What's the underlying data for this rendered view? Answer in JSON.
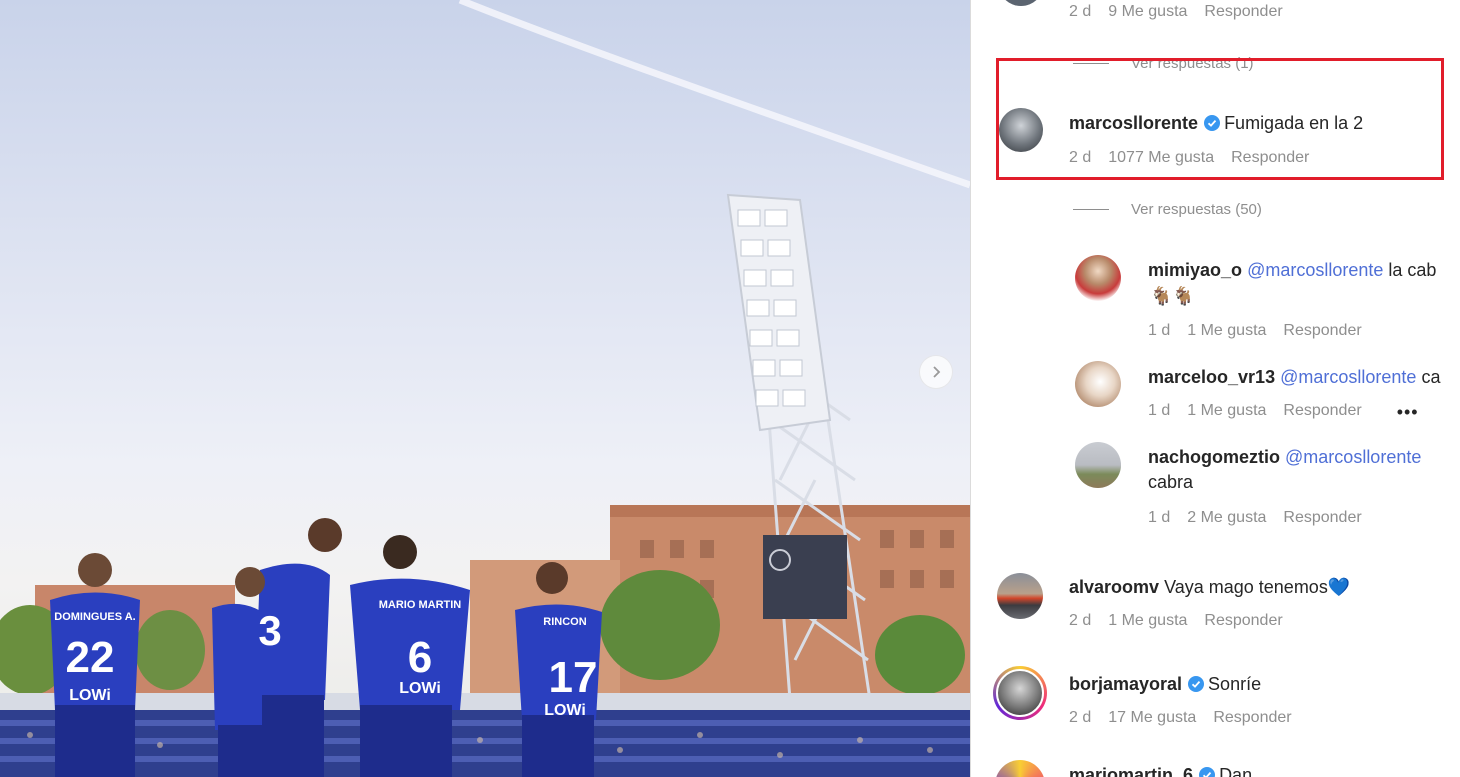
{
  "post": {
    "carousel_next_icon": "chevron-right-icon",
    "jerseys": [
      {
        "name": "DOMINGUES A.",
        "number": "22"
      },
      {
        "name": "",
        "number": "3"
      },
      {
        "name": "MARIO MARTIN",
        "number": "6"
      },
      {
        "name": "RINCON",
        "number": "17"
      }
    ],
    "sponsor": "LOWi"
  },
  "comments": [
    {
      "user": "",
      "text": "",
      "age": "2 d",
      "likes": "9 Me gusta",
      "reply": "Responder"
    },
    {
      "view_replies": "Ver respuestas (1)"
    },
    {
      "user": "marcosllorente",
      "verified": true,
      "text": "Fumigada en la 2",
      "age": "2 d",
      "likes": "1077 Me gusta",
      "reply": "Responder",
      "highlighted": true
    },
    {
      "view_replies": "Ver respuestas (50)"
    }
  ],
  "replies": [
    {
      "user": "mimiyao_o",
      "mention": "@marcosllorente",
      "text": "la cab",
      "line2": "🐐🐐",
      "age": "1 d",
      "likes": "1 Me gusta",
      "reply": "Responder"
    },
    {
      "user": "marceloo_vr13",
      "mention": "@marcosllorente",
      "text": "ca",
      "age": "1 d",
      "likes": "1 Me gusta",
      "reply": "Responder",
      "more": "•••"
    },
    {
      "user": "nachogomeztio",
      "mention": "@marcosllorente",
      "text": "",
      "line2": "cabra",
      "age": "1 d",
      "likes": "2 Me gusta",
      "reply": "Responder"
    }
  ],
  "more_comments": [
    {
      "user": "alvaroomv",
      "text": "Vaya mago tenemos💙",
      "age": "2 d",
      "likes": "1 Me gusta",
      "reply": "Responder"
    },
    {
      "user": "borjamayoral",
      "verified": true,
      "text": "Sonríe",
      "age": "2 d",
      "likes": "17 Me gusta",
      "reply": "Responder"
    },
    {
      "user": "mariomartin_6",
      "verified": true,
      "text": "Dan"
    }
  ],
  "colors": {
    "highlight": "#e11d2a",
    "mention": "#4f6fd6",
    "verified": "#3897f0",
    "kit": "#2a3fbf"
  }
}
